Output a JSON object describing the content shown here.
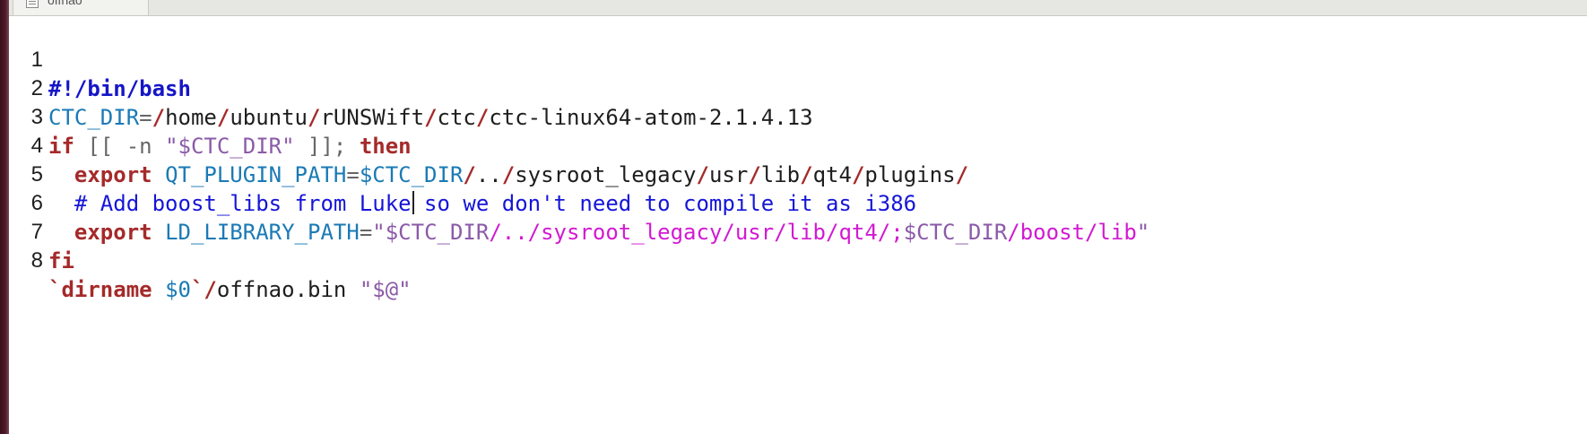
{
  "tab": {
    "label": "offnao"
  },
  "lines": [
    {
      "num": "1",
      "shebang": "#!/bin/bash"
    },
    {
      "num": "2",
      "var": "CTC_DIR",
      "eq": "=",
      "s1": "/",
      "p1": "home",
      "s2": "/",
      "p2": "ubuntu",
      "s3": "/",
      "p3": "rUNSWift",
      "s4": "/",
      "p4": "ctc",
      "s5": "/",
      "p5": "ctc-linux64-atom-2.1.4.13"
    },
    {
      "num": "3",
      "kw_if": "if",
      "test_open": " [[ -n ",
      "str": "\"$CTC_DIR\"",
      "test_close": " ]]; ",
      "kw_then": "then"
    },
    {
      "num": "4",
      "indent": "  ",
      "kw_export": "export",
      "sp": " ",
      "var": "QT_PLUGIN_PATH",
      "eq": "=",
      "var2": "$CTC_DIR",
      "s1": "/",
      "p1": "..",
      "s2": "/",
      "p2": "sysroot_legacy",
      "s3": "/",
      "p3": "usr",
      "s4": "/",
      "p4": "lib",
      "s5": "/",
      "p5": "qt4",
      "s6": "/",
      "p6": "plugins",
      "s7": "/"
    },
    {
      "num": "5",
      "indent": "  ",
      "comment_a": "# Add boost_libs from Luke",
      "comment_b": " so we don't need to compile it as i386"
    },
    {
      "num": "6",
      "indent": "  ",
      "kw_export": "export",
      "sp": " ",
      "var": "LD_LIBRARY_PATH",
      "eq": "=",
      "q1": "\"",
      "var2": "$CTC_DIR",
      "str_mid": "/../sysroot_legacy/usr/lib/qt4/;",
      "var3": "$CTC_DIR",
      "str_end": "/boost/lib",
      "q2": "\""
    },
    {
      "num": "7",
      "kw_fi": "fi"
    },
    {
      "num": "8",
      "bt1": "`",
      "kw_dirname": "dirname",
      "sp": " ",
      "var": "$0",
      "bt2": "`",
      "s1": "/",
      "p1": "offnao.bin ",
      "str": "\"$@\""
    }
  ]
}
